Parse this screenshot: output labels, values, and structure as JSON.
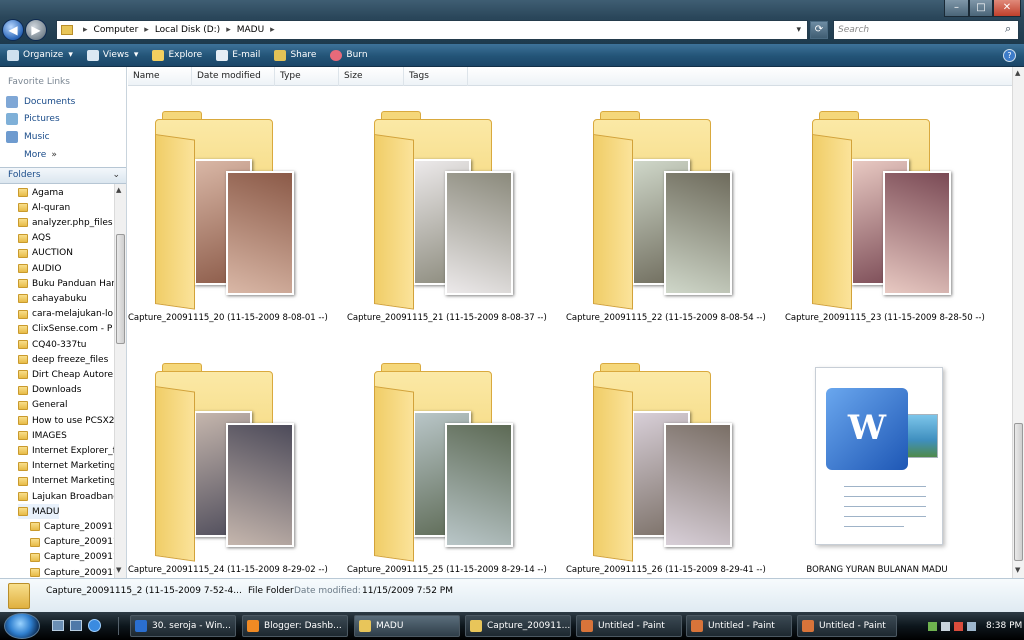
{
  "address": {
    "segments": [
      "Computer",
      "Local Disk (D:)",
      "MADU"
    ],
    "search_placeholder": "Search"
  },
  "toolbar": {
    "organize": "Organize",
    "views": "Views",
    "explore": "Explore",
    "email": "E-mail",
    "share": "Share",
    "burn": "Burn"
  },
  "favorites": {
    "header": "Favorite Links",
    "items": [
      "Documents",
      "Pictures",
      "Music"
    ],
    "more": "More"
  },
  "folders": {
    "header": "Folders",
    "items": [
      "Agama",
      "Al-quran",
      "analyzer.php_files",
      "AQS",
      "AUCTION",
      "AUDIO",
      "Buku Panduan Har",
      "cahayabuku",
      "cara-melajukan-lo",
      "ClixSense.com - P",
      "CQ40-337tu",
      "deep freeze_files",
      "Dirt Cheap Autore",
      "Downloads",
      "General",
      "How to use PCSX2",
      "IMAGES",
      "Internet Explorer_fi",
      "Internet Marketing",
      "Internet Marketing",
      "Lajukan Broadband",
      "MADU"
    ],
    "subitems": [
      "Capture_2009111",
      "Capture_2009111",
      "Capture_2009111",
      "Capture_2009111"
    ]
  },
  "columns": [
    "Name",
    "Date modified",
    "Type",
    "Size",
    "Tags"
  ],
  "tiles": [
    {
      "name": "Capture_20091115_20 (11-15-2009 8-08-01 --)",
      "kind": "folder",
      "c1": "#d9b7a6",
      "c2": "#8b5a48"
    },
    {
      "name": "Capture_20091115_21 (11-15-2009 8-08-37 --)",
      "kind": "folder",
      "c1": "#ece9ea",
      "c2": "#8b8a7c"
    },
    {
      "name": "Capture_20091115_22 (11-15-2009 8-08-54 --)",
      "kind": "folder",
      "c1": "#cfd7c9",
      "c2": "#6e6b5c"
    },
    {
      "name": "Capture_20091115_23 (11-15-2009 8-28-50 --)",
      "kind": "folder",
      "c1": "#e8c9c2",
      "c2": "#7a4a55"
    },
    {
      "name": "Capture_20091115_24 (11-15-2009 8-29-02 --)",
      "kind": "folder",
      "c1": "#c5b6ad",
      "c2": "#4d4b5a"
    },
    {
      "name": "Capture_20091115_25 (11-15-2009 8-29-14 --)",
      "kind": "folder",
      "c1": "#b9c6c8",
      "c2": "#5d6a55"
    },
    {
      "name": "Capture_20091115_26 (11-15-2009 8-29-41 --)",
      "kind": "folder",
      "c1": "#d8cfd8",
      "c2": "#7a6f66"
    },
    {
      "name": "BORANG YURAN BULANAN MADU",
      "kind": "word",
      "logo": "W"
    }
  ],
  "details": {
    "name": "Capture_20091115_2 (11-15-2009 7-52-4...",
    "type": "File Folder",
    "modified_label": "Date modified:",
    "modified_value": "11/15/2009 7:52 PM"
  },
  "taskbar": {
    "items": [
      {
        "label": "30. seroja - Win...",
        "color": "#2b6fd0"
      },
      {
        "label": "Blogger: Dashb...",
        "color": "#f08a24"
      },
      {
        "label": "MADU",
        "color": "#e8c55a"
      },
      {
        "label": "Capture_200911...",
        "color": "#e8c55a"
      },
      {
        "label": "Untitled - Paint",
        "color": "#d8743a"
      },
      {
        "label": "Untitled - Paint",
        "color": "#d8743a"
      },
      {
        "label": "Untitled - Paint",
        "color": "#d8743a"
      }
    ],
    "clock": "8:38 PM"
  }
}
